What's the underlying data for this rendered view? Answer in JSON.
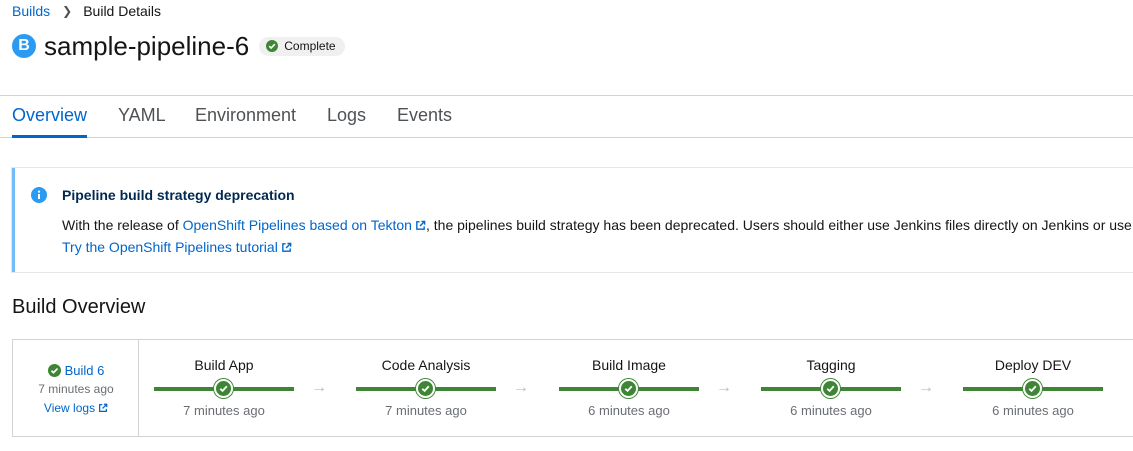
{
  "breadcrumb": {
    "parent": "Builds",
    "current": "Build Details"
  },
  "resource": {
    "badge": "B",
    "title": "sample-pipeline-6",
    "status": "Complete"
  },
  "tabs": [
    {
      "label": "Overview",
      "active": true
    },
    {
      "label": "YAML"
    },
    {
      "label": "Environment"
    },
    {
      "label": "Logs"
    },
    {
      "label": "Events"
    }
  ],
  "alert": {
    "title": "Pipeline build strategy deprecation",
    "body_prefix": "With the release of ",
    "body_link": "OpenShift Pipelines based on Tekton",
    "body_suffix": ", the pipelines build strategy has been deprecated. Users should either use Jenkins files directly on Jenkins or use",
    "tutorial_link": "Try the OpenShift Pipelines tutorial"
  },
  "build_overview": {
    "title": "Build Overview",
    "build_label": "Build 6",
    "build_time": "7 minutes ago",
    "view_logs": "View logs",
    "stages": [
      {
        "name": "Build App",
        "time": "7 minutes ago"
      },
      {
        "name": "Code Analysis",
        "time": "7 minutes ago"
      },
      {
        "name": "Build Image",
        "time": "6 minutes ago"
      },
      {
        "name": "Tagging",
        "time": "6 minutes ago"
      },
      {
        "name": "Deploy DEV",
        "time": "6 minutes ago"
      }
    ],
    "arrow": "→"
  },
  "colors": {
    "accent": "#0066cc",
    "success": "#3e8635",
    "info": "#73bcf7",
    "badge": "#2b9af3"
  }
}
